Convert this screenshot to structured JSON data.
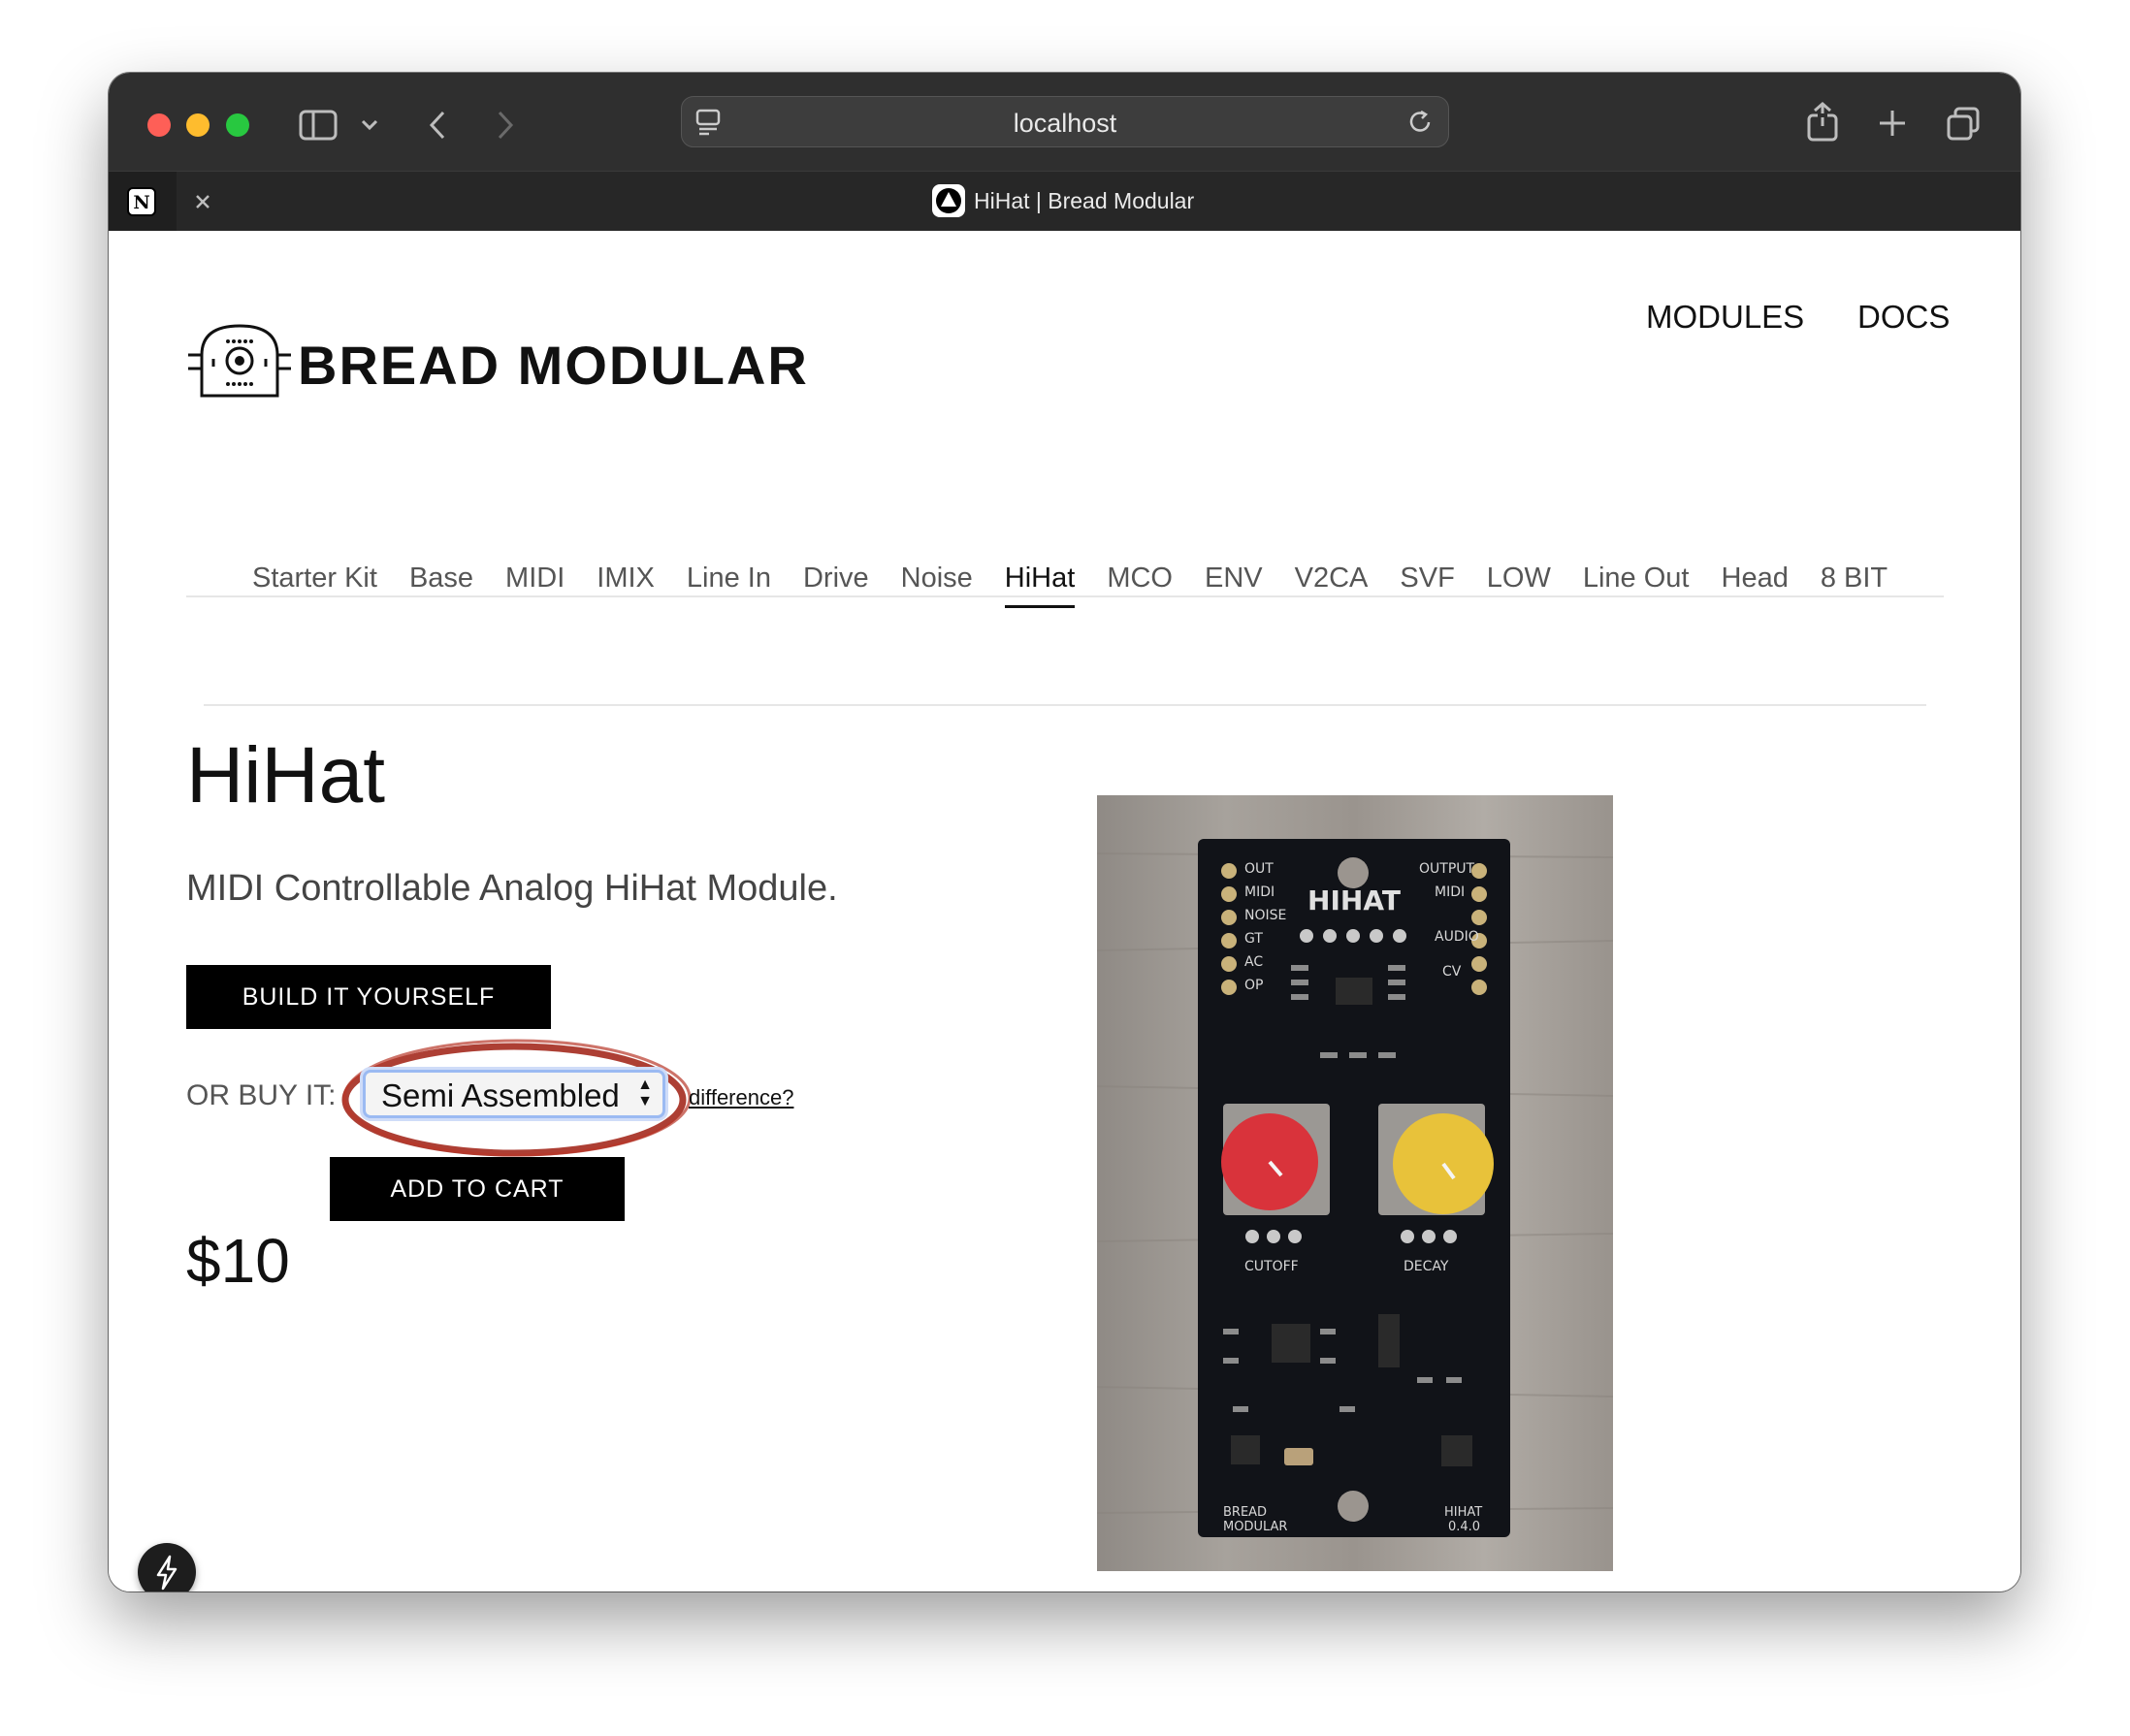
{
  "browser": {
    "url": "localhost",
    "tab_title": "HiHat | Bread Modular"
  },
  "site": {
    "brand": "BREAD MODULAR",
    "nav": [
      "MODULES",
      "DOCS"
    ]
  },
  "module_nav": {
    "items": [
      "Starter Kit",
      "Base",
      "MIDI",
      "IMIX",
      "Line In",
      "Drive",
      "Noise",
      "HiHat",
      "MCO",
      "ENV",
      "V2CA",
      "SVF",
      "LOW",
      "Line Out",
      "Head",
      "8 BIT"
    ],
    "active": "HiHat"
  },
  "product": {
    "title": "HiHat",
    "subtitle": "MIDI Controllable Analog HiHat Module.",
    "build_button": "BUILD IT YOURSELF",
    "or_buy_label": "OR BUY IT:",
    "select_value": "Semi Assembled",
    "difference_link": "difference?",
    "price": "$10",
    "add_to_cart": "ADD TO CART"
  },
  "pcb": {
    "left_labels": [
      "OUT",
      "MIDI",
      "NOISE",
      "GT",
      "AC",
      "OP"
    ],
    "right_labels": [
      "OUTPUT",
      "MIDI",
      "AUDIO",
      "CV"
    ],
    "title": "HIHAT",
    "knob_labels": [
      "CUTOFF",
      "DECAY"
    ],
    "footer_left": [
      "BREAD",
      "MODULAR"
    ],
    "footer_right": [
      "HIHAT",
      "0.4.0"
    ],
    "knob_colors": [
      "#d9333b",
      "#e8c23a"
    ]
  }
}
